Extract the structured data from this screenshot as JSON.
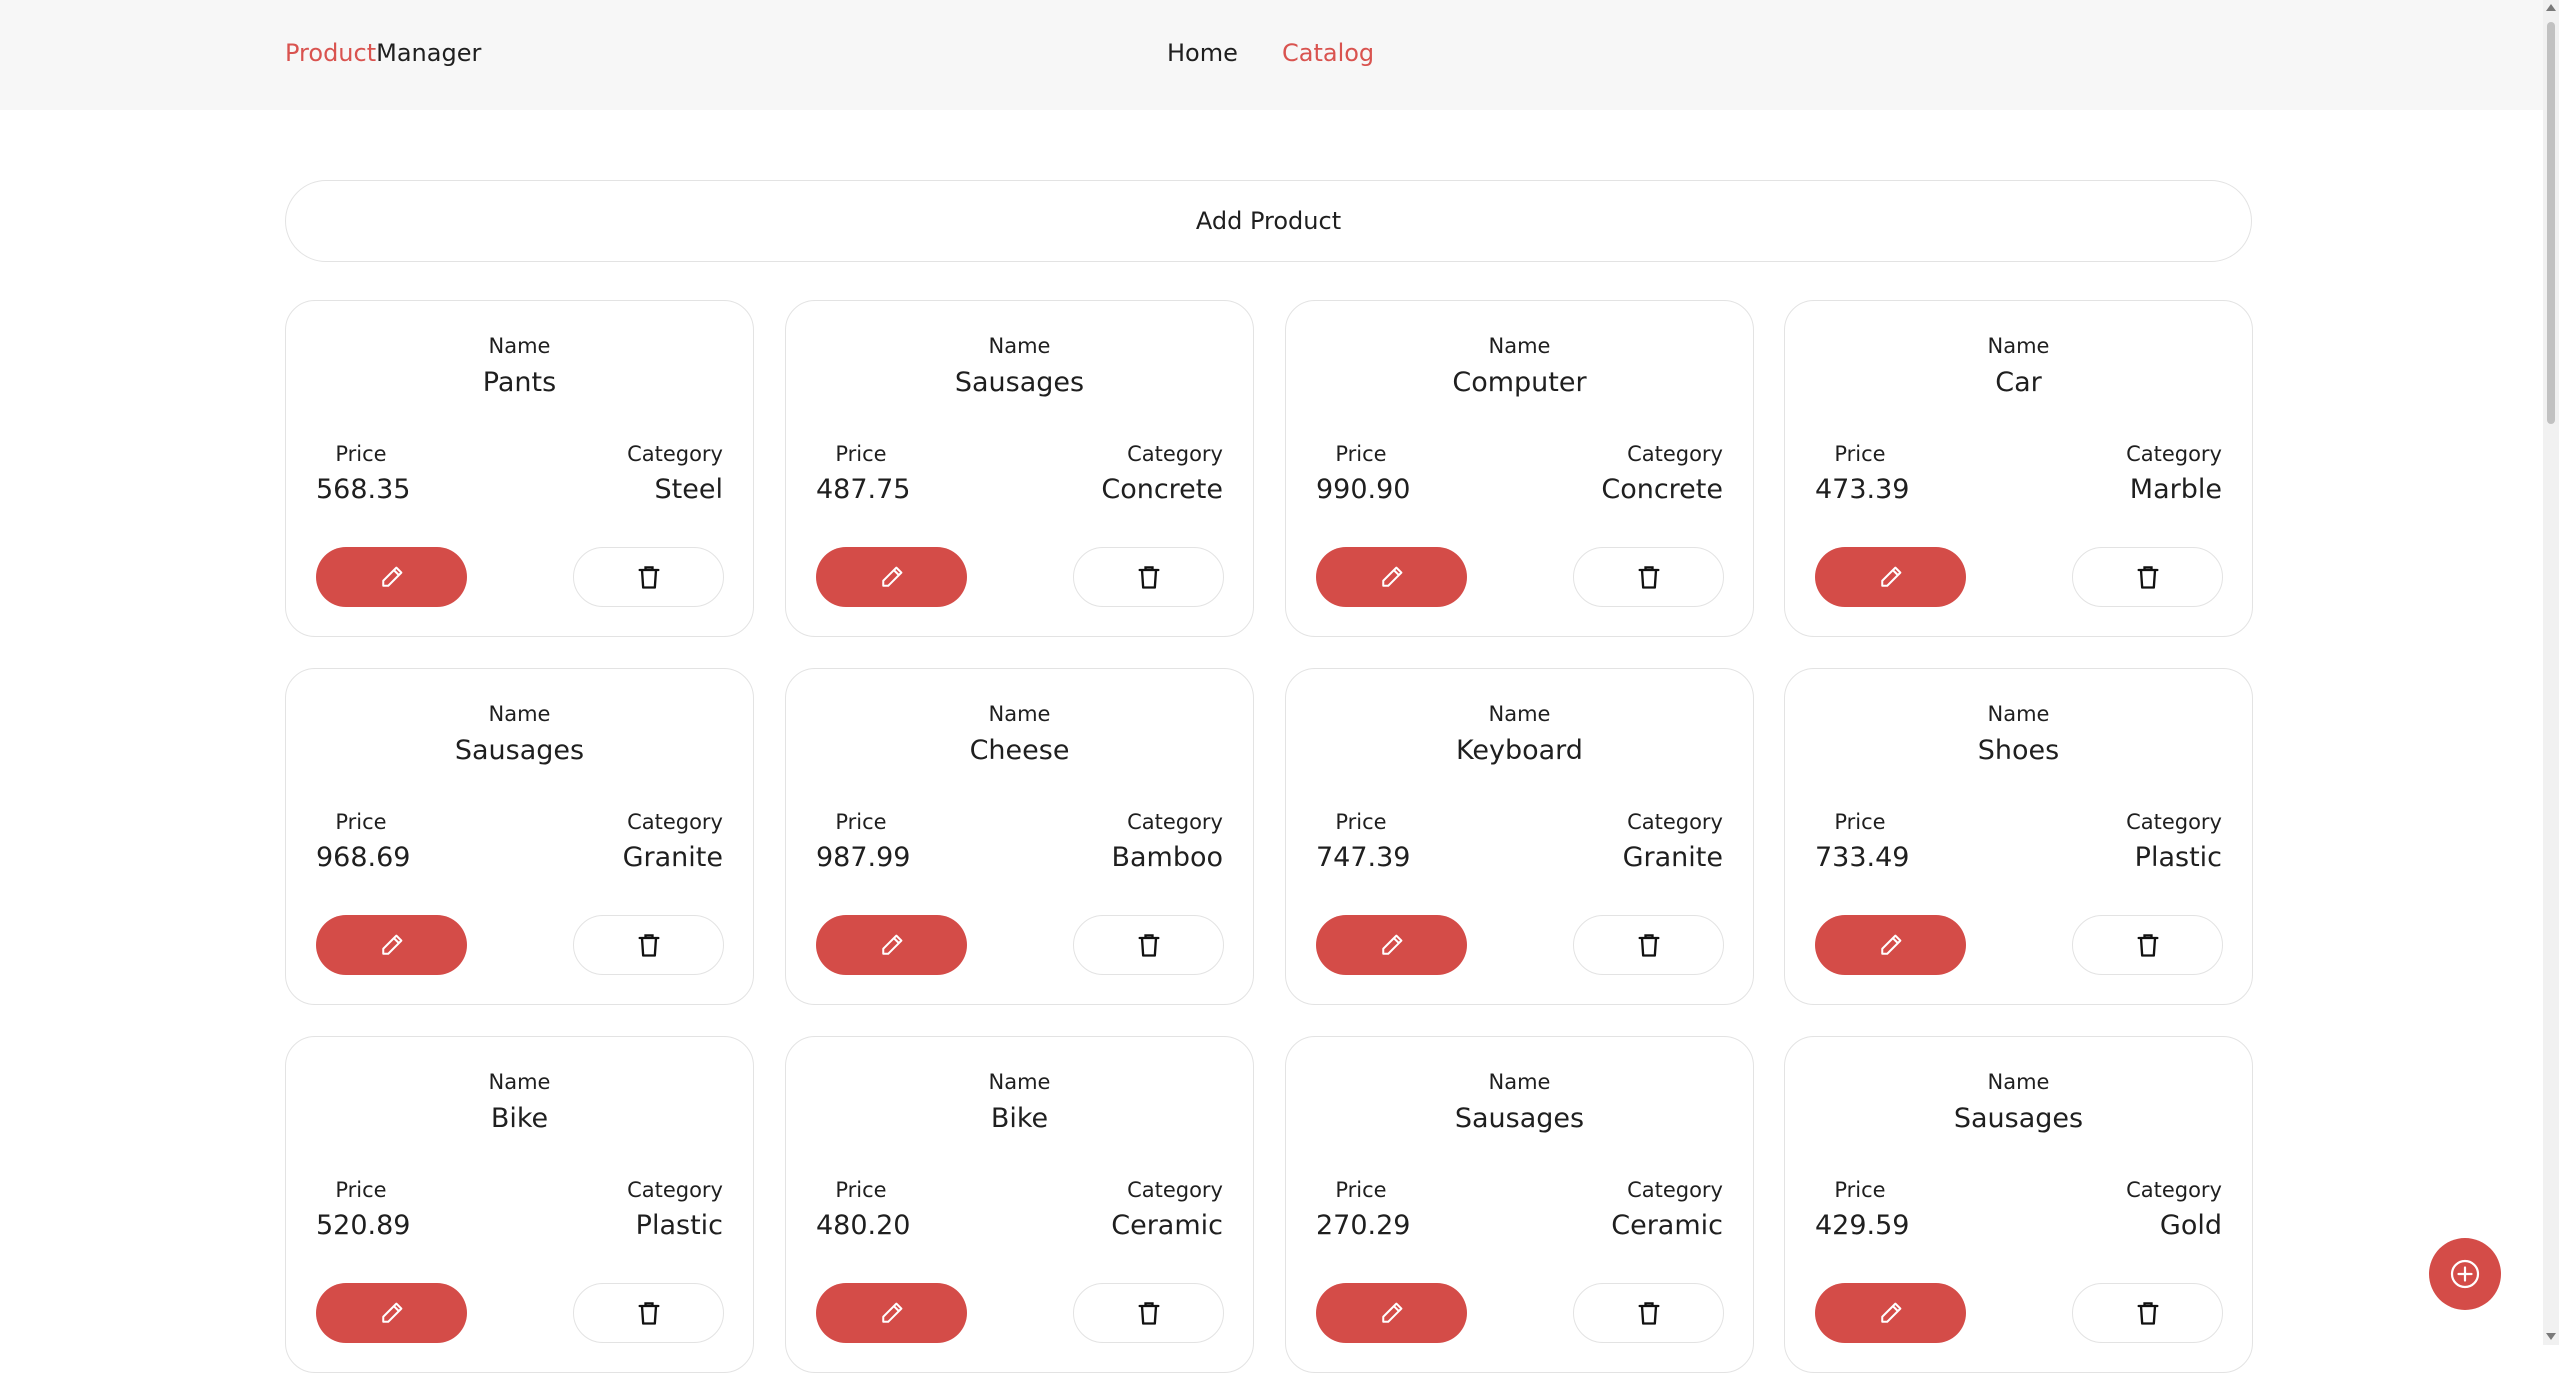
{
  "header": {
    "brand_accent": "Product",
    "brand_rest": "Manager",
    "nav": {
      "home": "Home",
      "catalog": "Catalog"
    }
  },
  "add_product_label": "Add Product",
  "labels": {
    "name": "Name",
    "price": "Price",
    "category": "Category"
  },
  "products": [
    {
      "name": "Pants",
      "price": "568.35",
      "category": "Steel"
    },
    {
      "name": "Sausages",
      "price": "487.75",
      "category": "Concrete"
    },
    {
      "name": "Computer",
      "price": "990.90",
      "category": "Concrete"
    },
    {
      "name": "Car",
      "price": "473.39",
      "category": "Marble"
    },
    {
      "name": "Sausages",
      "price": "968.69",
      "category": "Granite"
    },
    {
      "name": "Cheese",
      "price": "987.99",
      "category": "Bamboo"
    },
    {
      "name": "Keyboard",
      "price": "747.39",
      "category": "Granite"
    },
    {
      "name": "Shoes",
      "price": "733.49",
      "category": "Plastic"
    },
    {
      "name": "Bike",
      "price": "520.89",
      "category": "Plastic"
    },
    {
      "name": "Bike",
      "price": "480.20",
      "category": "Ceramic"
    },
    {
      "name": "Sausages",
      "price": "270.29",
      "category": "Ceramic"
    },
    {
      "name": "Sausages",
      "price": "429.59",
      "category": "Gold"
    }
  ],
  "icons": {
    "edit": "pencil-icon",
    "delete": "trash-icon",
    "fab": "plus-circle-icon"
  },
  "colors": {
    "accent": "#d44c48",
    "brand_accent": "#d9534f",
    "header_bg": "#f7f7f7",
    "border": "#e3e3e3"
  }
}
